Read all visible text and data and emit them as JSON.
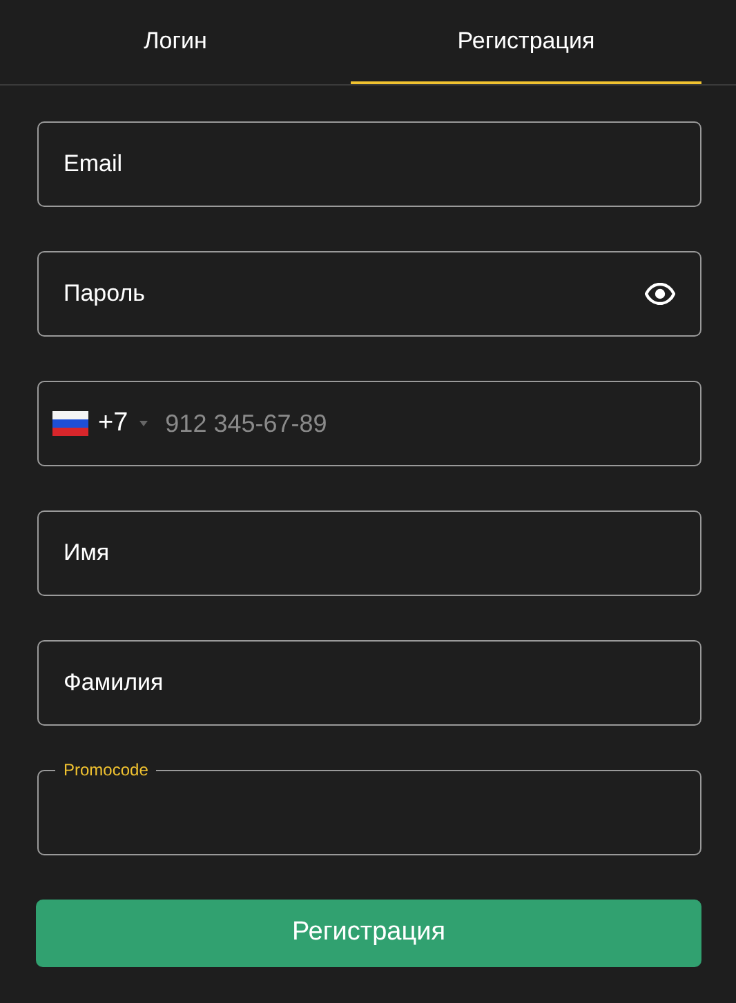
{
  "tabs": [
    {
      "label": "Логин",
      "selected": false
    },
    {
      "label": "Регистрация",
      "selected": true
    }
  ],
  "fields": [
    {
      "kind": "text",
      "label": "Email"
    },
    {
      "kind": "password",
      "label": "Пароль"
    },
    {
      "kind": "phone",
      "code": "+7",
      "placeholder": "912 345-67-89"
    },
    {
      "kind": "text",
      "label": "Имя"
    },
    {
      "kind": "text",
      "label": "Фамилия"
    },
    {
      "kind": "outlined",
      "label": "Promocode"
    }
  ],
  "submit": {
    "label": "Регистрация"
  }
}
